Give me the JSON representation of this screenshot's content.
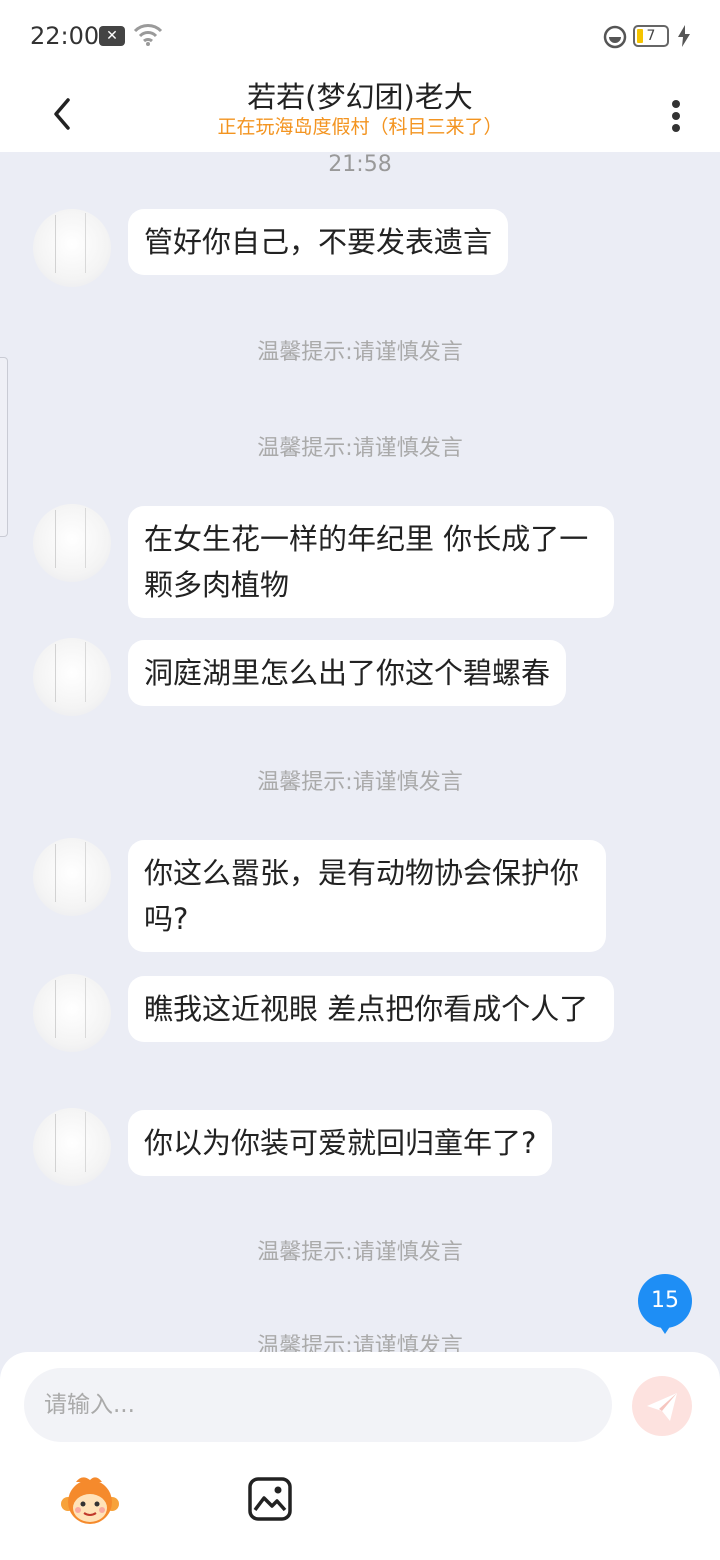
{
  "status_bar": {
    "time": "22:00",
    "battery": "7"
  },
  "header": {
    "title": "若若(梦幻团)老大",
    "subtitle": "正在玩海岛度假村（科目三来了）"
  },
  "chat": {
    "timestamp": "21:58",
    "tip_text": "温馨提示:请谨慎发言",
    "messages": [
      "管好你自己，不要发表遗言",
      "在女生花一样的年纪里 你长成了一颗多肉植物",
      "洞庭湖里怎么出了你这个碧螺春",
      "你这么嚣张，是有动物协会保护你吗?",
      "瞧我这近视眼 差点把你看成个人了",
      "你以为你装可爱就回归童年了?"
    ],
    "unread_count": "15"
  },
  "input": {
    "placeholder": "请输入..."
  },
  "colors": {
    "accent_orange": "#f39420",
    "badge_blue": "#1e8ef5",
    "background": "#ebedf5"
  },
  "icons": [
    "back-arrow-icon",
    "more-dots-icon",
    "send-icon",
    "monkey-emoji-icon",
    "image-icon",
    "wifi-icon",
    "battery-icon"
  ]
}
